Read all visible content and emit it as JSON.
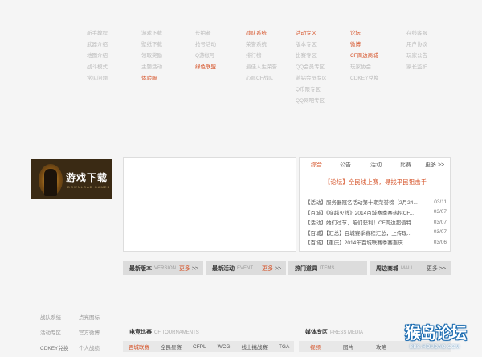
{
  "nav_columns": [
    {
      "items": [
        {
          "label": "新手教程"
        },
        {
          "label": "武器介绍"
        },
        {
          "label": "地图介绍"
        },
        {
          "label": "战斗模式"
        },
        {
          "label": "常见问题"
        }
      ]
    },
    {
      "items": [
        {
          "label": "游戏下载"
        },
        {
          "label": "壁纸下载"
        },
        {
          "label": "领取奖励"
        },
        {
          "label": "主题活动"
        },
        {
          "label": "体验服",
          "hl": true
        }
      ]
    },
    {
      "items": [
        {
          "label": "长拍者"
        },
        {
          "label": "抢号活动"
        },
        {
          "label": "Q游帐号"
        },
        {
          "label": "绿色联盟",
          "hl": true
        }
      ]
    },
    {
      "items": [
        {
          "label": "战队系统",
          "hl": true
        },
        {
          "label": "荣誉系统"
        },
        {
          "label": "排行榜"
        },
        {
          "label": "最佳人生荣誉"
        },
        {
          "label": "心愿CF战队"
        }
      ]
    },
    {
      "items": [
        {
          "label": "活动专区",
          "hl": true
        },
        {
          "label": "版本专区"
        },
        {
          "label": "比赛专区"
        },
        {
          "label": "QQ会员专区"
        },
        {
          "label": "蓝钻会员专区"
        },
        {
          "label": "Q币限专区"
        },
        {
          "label": "QQ网吧专区"
        }
      ]
    },
    {
      "items": [
        {
          "label": "论坛",
          "hl": true
        },
        {
          "label": "微博",
          "hl": true
        },
        {
          "label": "CF周边商城",
          "hl": true
        },
        {
          "label": "玩家协会"
        },
        {
          "label": "CDKEY兑换"
        }
      ]
    },
    {
      "items": [
        {
          "label": "在线客服"
        },
        {
          "label": "用户协议"
        },
        {
          "label": "玩家公告"
        },
        {
          "label": "家长监护"
        }
      ]
    }
  ],
  "banner": {
    "title": "游戏下载",
    "sub": "DOWNLOAD GAMES"
  },
  "news": {
    "tabs": [
      "综合",
      "公告",
      "活动",
      "比赛"
    ],
    "more": "更多 >>",
    "headline": "【论坛】全民线上赛，寻找平民狙击手",
    "items": [
      {
        "text": "【活动】服务器冠名活动第十期荣誉榜（2月24...",
        "date": "03/11"
      },
      {
        "text": "【百城】《穿越火线》2014百城赛季赛热招CF...",
        "date": "03/07"
      },
      {
        "text": "【活动】她们过节，咱们获利！CF周边超值特...",
        "date": "03/07"
      },
      {
        "text": "【百城】【汇总】百城赛季赛程汇总，上传现...",
        "date": "03/07"
      },
      {
        "text": "【百城】【重庆】2014年百城联赛季赛重庆...",
        "date": "03/06"
      }
    ]
  },
  "bars": [
    {
      "label": "最新版本",
      "en": "VERSION",
      "more": "更多"
    },
    {
      "label": "最新活动",
      "en": "EVENT",
      "more": "更多"
    },
    {
      "label": "热门道具",
      "en": "ITEMS",
      "more": ""
    },
    {
      "label": "周边商城",
      "en": "MALL",
      "more": "更多"
    }
  ],
  "bottom_links": [
    {
      "label": "战队系统"
    },
    {
      "label": "点亮图标"
    },
    {
      "label": "活动专区"
    },
    {
      "label": "官方微博"
    },
    {
      "label": "CDKEY兑换",
      "dk": true
    },
    {
      "label": "个人战绩"
    }
  ],
  "tournaments": {
    "title": "电竞比赛",
    "en": "CF TOURNAMENTS",
    "tabs": [
      "百城联赛",
      "全民星赛",
      "CFPL",
      "WCG",
      "线上挑战赛",
      "TGA"
    ]
  },
  "media": {
    "title": "媒体专区",
    "en": "PRESS MEDIA",
    "tabs": [
      "视频",
      "图片",
      "攻略"
    ]
  },
  "watermark": {
    "main": "猴岛论坛",
    "sub": "BBS.HOUDAO.COM"
  }
}
